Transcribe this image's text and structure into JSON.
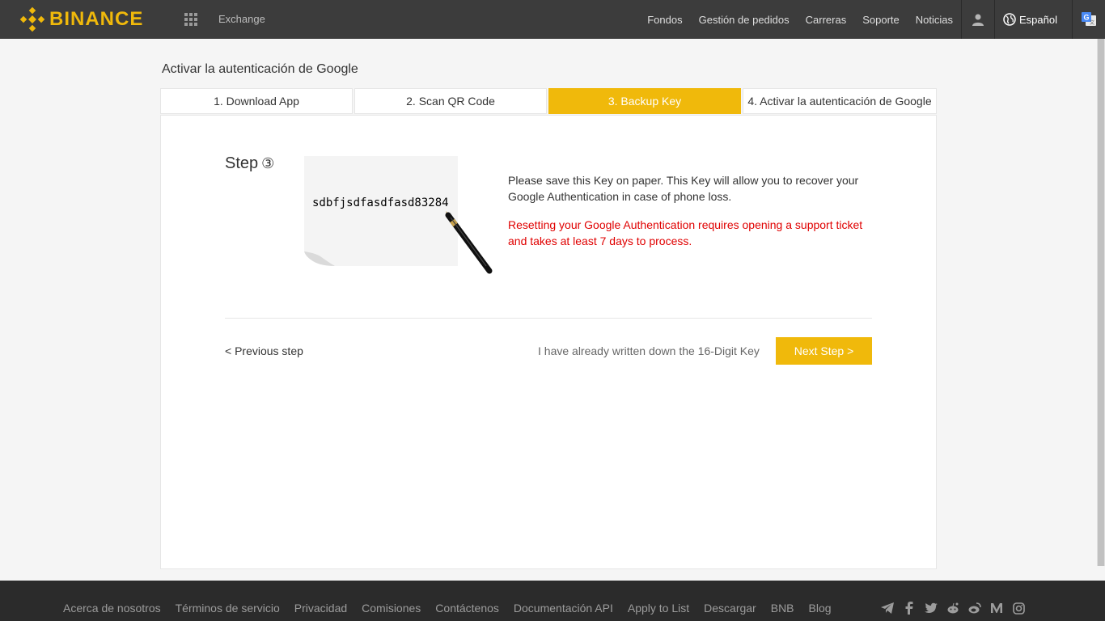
{
  "header": {
    "brand": "BINANCE",
    "exchange_label": "Exchange",
    "nav": [
      "Fondos",
      "Gestión de pedidos",
      "Carreras",
      "Soporte",
      "Noticias"
    ],
    "language": "Español",
    "brand_color": "#f0b90b"
  },
  "page": {
    "title": "Activar la autenticación de Google",
    "steps": [
      {
        "label": "1. Download App",
        "active": false
      },
      {
        "label": "2. Scan QR Code",
        "active": false
      },
      {
        "label": "3. Backup Key",
        "active": true
      },
      {
        "label": "4. Activar la autenticación de Google",
        "active": false
      }
    ],
    "step_label": "Step",
    "step_number": "③",
    "backup_key": "sdbfjsdfasdfasd83284",
    "description": "Please save this Key on paper. This Key will allow you to recover your Google Authentication in case of phone loss.",
    "warning": "Resetting your Google Authentication requires opening a support ticket and takes at least 7 days to process.",
    "previous_step": "< Previous step",
    "confirmation_text": "I have already written down the 16-Digit Key",
    "next_step": "Next Step >"
  },
  "footer": {
    "links": [
      "Acerca de nosotros",
      "Términos de servicio",
      "Privacidad",
      "Comisiones",
      "Contáctenos",
      "Documentación API",
      "Apply to List",
      "Descargar",
      "BNB",
      "Blog"
    ],
    "social_icons": [
      "telegram-icon",
      "facebook-icon",
      "twitter-icon",
      "reddit-icon",
      "weibo-icon",
      "medium-icon",
      "instagram-icon"
    ]
  }
}
